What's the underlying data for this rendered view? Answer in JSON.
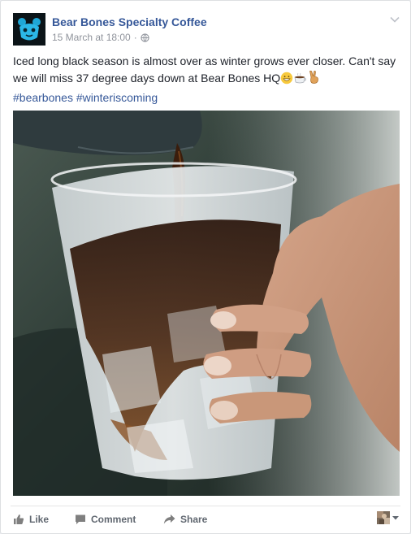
{
  "post": {
    "page_name": "Bear Bones Specialty Coffee",
    "timestamp": "15 March at 18:00",
    "separator": "·",
    "audience_icon": "globe-icon",
    "text_line": "Iced long black season is almost over as winter grows ever closer. Can't say we will miss 37 degree days down at Bear Bones HQ",
    "emojis": [
      "grinning-face-emoji",
      "hot-beverage-emoji",
      "victory-hand-emoji"
    ],
    "hashtags": [
      "#bearbones",
      "#winteriscoming"
    ],
    "photo_alt": "iced-coffee-pour-photo"
  },
  "actions": {
    "like": "Like",
    "comment": "Comment",
    "share": "Share"
  },
  "colors": {
    "link": "#365899",
    "text": "#1d2129",
    "muted": "#90949c",
    "action": "#606770",
    "background": "#e9ebee"
  }
}
